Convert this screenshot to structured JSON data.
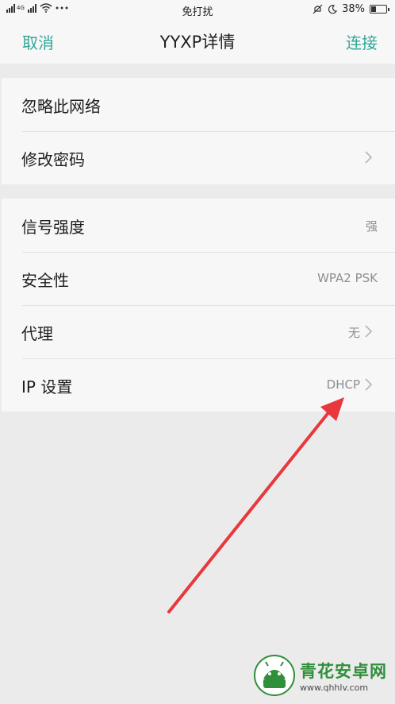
{
  "status_bar": {
    "network_label": "4G",
    "center_text": "免打扰",
    "battery_percent": "38%",
    "battery_level": 0.38,
    "icons": [
      "signal-icon",
      "wifi-icon",
      "more-icon",
      "mute-icon",
      "moon-icon",
      "battery-icon"
    ]
  },
  "nav": {
    "cancel": "取消",
    "title": "YYXP详情",
    "connect": "连接"
  },
  "group1": [
    {
      "label": "忽略此网络"
    },
    {
      "label": "修改密码"
    }
  ],
  "group2": [
    {
      "label": "信号强度",
      "value": "强"
    },
    {
      "label": "安全性",
      "value": "WPA2 PSK"
    },
    {
      "label": "代理",
      "value": "无"
    },
    {
      "label": "IP 设置",
      "value": "DHCP"
    }
  ],
  "watermark": {
    "title": "青花安卓网",
    "url": "www.qhhlv.com"
  },
  "colors": {
    "accent": "#2fa798",
    "arrow": "#e8383d",
    "background": "#ebebeb",
    "panel": "#f7f7f7"
  }
}
